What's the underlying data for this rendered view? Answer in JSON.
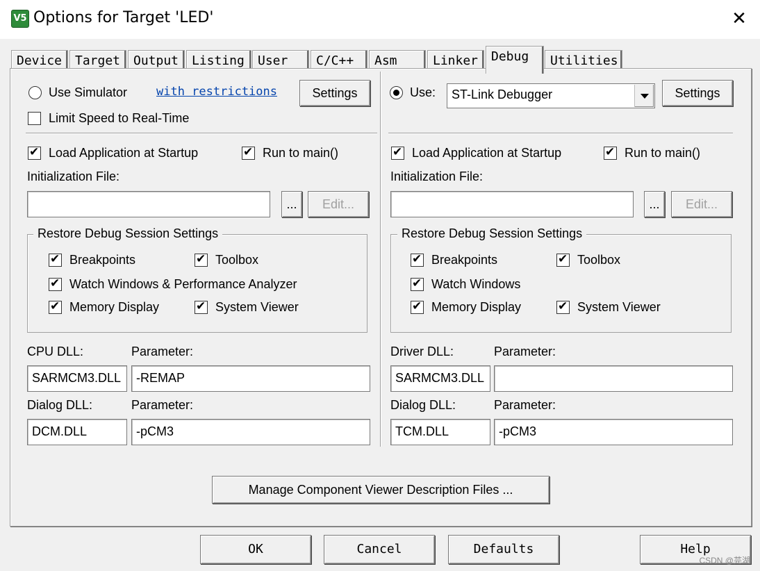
{
  "window": {
    "title": "Options for Target 'LED'",
    "close_symbol": "✕"
  },
  "tabs": [
    {
      "label": "Device"
    },
    {
      "label": "Target"
    },
    {
      "label": "Output"
    },
    {
      "label": "Listing"
    },
    {
      "label": "User"
    },
    {
      "label": "C/C++"
    },
    {
      "label": "Asm"
    },
    {
      "label": "Linker"
    },
    {
      "label": "Debug",
      "active": true
    },
    {
      "label": "Utilities"
    }
  ],
  "left": {
    "use_simulator": "Use Simulator",
    "with_restrictions": "with restrictions",
    "settings": "Settings",
    "limit_speed": "Limit Speed to Real-Time",
    "load_app": "Load Application at Startup",
    "run_to_main": "Run to main()",
    "init_file_label": "Initialization File:",
    "init_file_value": "",
    "browse": "...",
    "edit": "Edit...",
    "restore_title": "Restore Debug Session Settings",
    "breakpoints": "Breakpoints",
    "toolbox": "Toolbox",
    "watch_windows": "Watch Windows & Performance Analyzer",
    "memory_display": "Memory Display",
    "system_viewer": "System Viewer",
    "dll_label": "CPU DLL:",
    "param_label": "Parameter:",
    "dll_value": "SARMCM3.DLL",
    "dll_param": "-REMAP",
    "dialog_dll_label": "Dialog DLL:",
    "dialog_param_label": "Parameter:",
    "dialog_dll_value": "DCM.DLL",
    "dialog_param": "-pCM3"
  },
  "right": {
    "use": "Use:",
    "debugger": "ST-Link Debugger",
    "settings": "Settings",
    "load_app": "Load Application at Startup",
    "run_to_main": "Run to main()",
    "init_file_label": "Initialization File:",
    "init_file_value": "",
    "browse": "...",
    "edit": "Edit...",
    "restore_title": "Restore Debug Session Settings",
    "breakpoints": "Breakpoints",
    "toolbox": "Toolbox",
    "watch_windows": "Watch Windows",
    "memory_display": "Memory Display",
    "system_viewer": "System Viewer",
    "dll_label": "Driver DLL:",
    "param_label": "Parameter:",
    "dll_value": "SARMCM3.DLL",
    "dll_param": "",
    "dialog_dll_label": "Dialog DLL:",
    "dialog_param_label": "Parameter:",
    "dialog_dll_value": "TCM.DLL",
    "dialog_param": "-pCM3"
  },
  "manage_button": "Manage Component Viewer Description Files ...",
  "footer": {
    "ok": "OK",
    "cancel": "Cancel",
    "defaults": "Defaults",
    "help": "Help"
  },
  "watermark": "CSDN @芫湖"
}
